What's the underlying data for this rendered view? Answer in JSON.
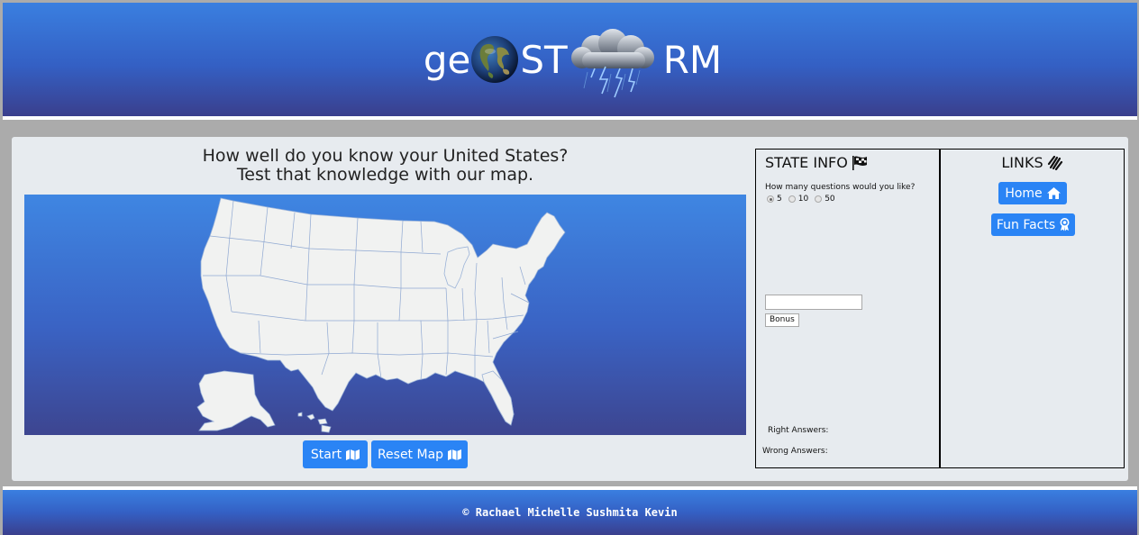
{
  "header": {
    "logo_part1": "ge",
    "logo_part2": "ST",
    "logo_part3": "RM"
  },
  "main": {
    "headline_line1": "How well do you know your United States?",
    "headline_line2": "Test that knowledge with our map.",
    "start_label": "Start",
    "reset_label": "Reset Map"
  },
  "state_info": {
    "title": "STATE INFO",
    "question": "How many questions would you like?",
    "options": [
      "5",
      "10",
      "50"
    ],
    "selected_option": "5",
    "bonus_input_value": "",
    "bonus_label": "Bonus",
    "right_answers_label": "Right Answers:",
    "wrong_answers_label": "Wrong Answers:"
  },
  "links": {
    "title": "LINKS",
    "home_label": "Home",
    "fun_facts_label": "Fun Facts"
  },
  "footer": {
    "text": "© Rachael Michelle Sushmita Kevin"
  },
  "colors": {
    "brand_blue": "#3a7fe0",
    "brand_dark": "#3a3f8d",
    "button_blue": "#2a84f5",
    "map_land": "#f1f2f1",
    "panel_bg": "#e7ebef"
  },
  "icons": {
    "start": "map-icon",
    "reset": "map-icon",
    "state_info": "flag-checkered-icon",
    "links": "link-icon",
    "home": "home-icon",
    "fun_facts": "award-icon"
  }
}
